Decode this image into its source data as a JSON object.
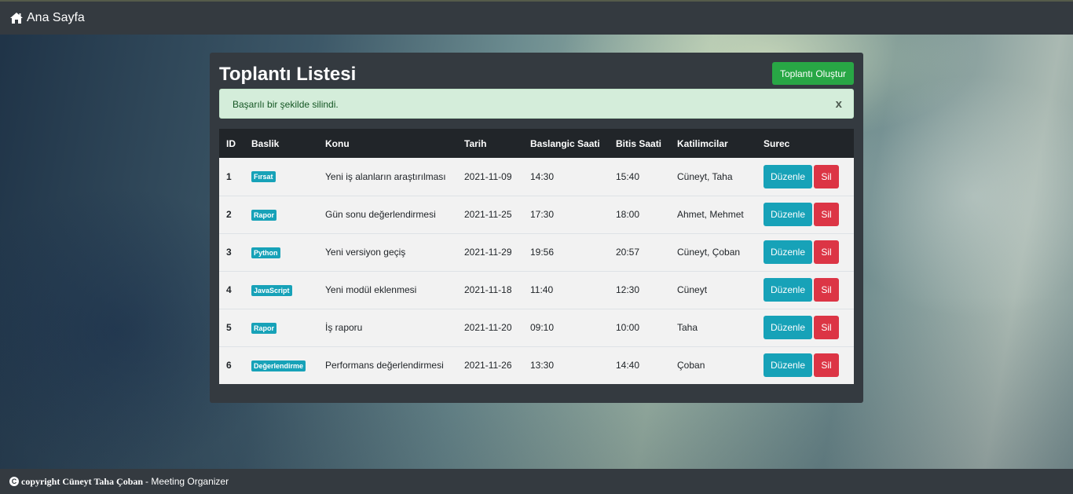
{
  "navbar": {
    "brand_icon": "home-icon",
    "brand_label": "Ana Sayfa"
  },
  "panel": {
    "title_part1": "Toplantı",
    "title_part2": "Listesi",
    "create_button": "Toplantı Oluştur"
  },
  "alert": {
    "message": "Başarılı bir şekilde silindi.",
    "close_label": "x"
  },
  "table": {
    "columns": [
      "ID",
      "Baslik",
      "Konu",
      "Tarih",
      "Baslangic Saati",
      "Bitis Saati",
      "Katilimcilar",
      "Surec"
    ],
    "rows": [
      {
        "id": "1",
        "badge": "Fırsat",
        "topic": "Yeni iş alanların araştırılması",
        "date": "2021-11-09",
        "start": "14:30",
        "end": "15:40",
        "participants": "Cüneyt, Taha",
        "edit": "Düzenle",
        "delete": "Sil"
      },
      {
        "id": "2",
        "badge": "Rapor",
        "topic": "Gün sonu değerlendirmesi",
        "date": "2021-11-25",
        "start": "17:30",
        "end": "18:00",
        "participants": "Ahmet, Mehmet",
        "edit": "Düzenle",
        "delete": "Sil"
      },
      {
        "id": "3",
        "badge": "Python",
        "topic": "Yeni versiyon geçiş",
        "date": "2021-11-29",
        "start": "19:56",
        "end": "20:57",
        "participants": "Cüneyt, Çoban",
        "edit": "Düzenle",
        "delete": "Sil"
      },
      {
        "id": "4",
        "badge": "JavaScript",
        "topic": "Yeni modül eklenmesi",
        "date": "2021-11-18",
        "start": "11:40",
        "end": "12:30",
        "participants": "Cüneyt",
        "edit": "Düzenle",
        "delete": "Sil"
      },
      {
        "id": "5",
        "badge": "Rapor",
        "topic": "İş raporu",
        "date": "2021-11-20",
        "start": "09:10",
        "end": "10:00",
        "participants": "Taha",
        "edit": "Düzenle",
        "delete": "Sil"
      },
      {
        "id": "6",
        "badge": "Değerlendirme",
        "topic": "Performans değerlendirmesi",
        "date": "2021-11-26",
        "start": "13:30",
        "end": "14:40",
        "participants": "Çoban",
        "edit": "Düzenle",
        "delete": "Sil"
      }
    ]
  },
  "footer": {
    "copyright_icon": "copyright-icon",
    "copyright_text": "copyright Cüneyt Taha Çoban",
    "app_text": "- Meeting Organizer"
  },
  "colors": {
    "navbar": "#343a40",
    "success": "#28a745",
    "info": "#17a2b8",
    "danger": "#dc3545",
    "table_header": "#212529"
  }
}
